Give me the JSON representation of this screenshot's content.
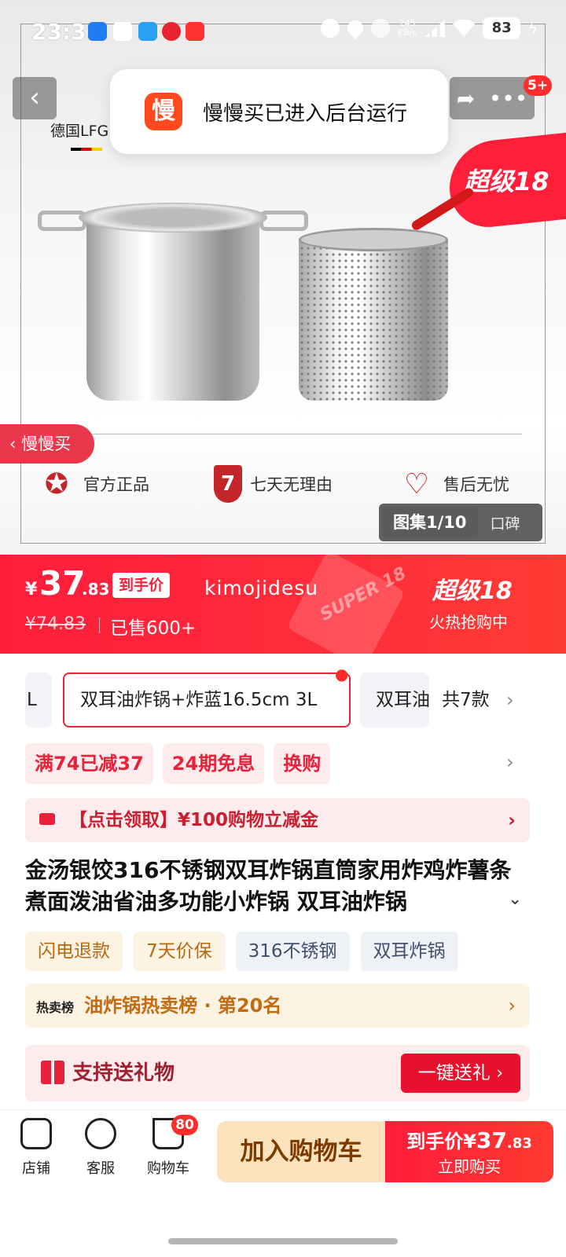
{
  "status_bar": {
    "time": "23:31",
    "net_speed": "245\nKB/s",
    "battery": "83"
  },
  "hero": {
    "brand_label": "德国LFG",
    "gallery_label": "图集1/10",
    "reviews_label": "口碑",
    "side_label": "慢慢买",
    "super_tag": "超级18",
    "message_badge": "5+",
    "guarantees": [
      "官方正品",
      "七天无理由",
      "售后无忧"
    ],
    "guarantee_seven_number": "7"
  },
  "toast": {
    "logo_char": "慢",
    "text": "慢慢买已进入后台运行"
  },
  "price": {
    "yen": "¥",
    "integer": "37",
    "decimal": ".83",
    "badge": "到手价",
    "seller": "kimojidesu",
    "original": "¥74.83",
    "sold": "已售600+",
    "super_label": "超级18",
    "super_sub": "火热抢购中",
    "watermark": "SUPER 18"
  },
  "variants": {
    "items": [
      "L",
      "双耳油炸锅+炸蓝16.5cm 3L",
      "双耳油"
    ],
    "selected_index": 1,
    "count_label": "共7款"
  },
  "promos": [
    "满74已减37",
    "24期免息",
    "换购"
  ],
  "coupon": {
    "text": "【点击领取】¥100购物立减金"
  },
  "product": {
    "title": "金汤银饺316不锈钢双耳炸锅直筒家用炸鸡炸薯条煮面泼油省油多功能小炸锅 双耳油炸锅",
    "tags": [
      "闪电退款",
      "7天价保",
      "316不锈钢",
      "双耳炸锅"
    ]
  },
  "rank": {
    "tag": "热卖榜",
    "text": "油炸锅热卖榜 · 第20名"
  },
  "gift": {
    "text": "支持送礼物",
    "button": "一键送礼 ›"
  },
  "bottom_bar": {
    "tabs": [
      "店铺",
      "客服",
      "购物车"
    ],
    "cart_badge": "80",
    "add_cart": "加入购物车",
    "buy_prefix": "到手价",
    "buy_yen": "¥",
    "buy_int": "37",
    "buy_dec": ".83",
    "buy_sub": "立即购买"
  },
  "colors": {
    "accent_red": "#ff1d3b",
    "promo_bg": "#fdecee",
    "rank_bg": "#fdf3e3"
  }
}
